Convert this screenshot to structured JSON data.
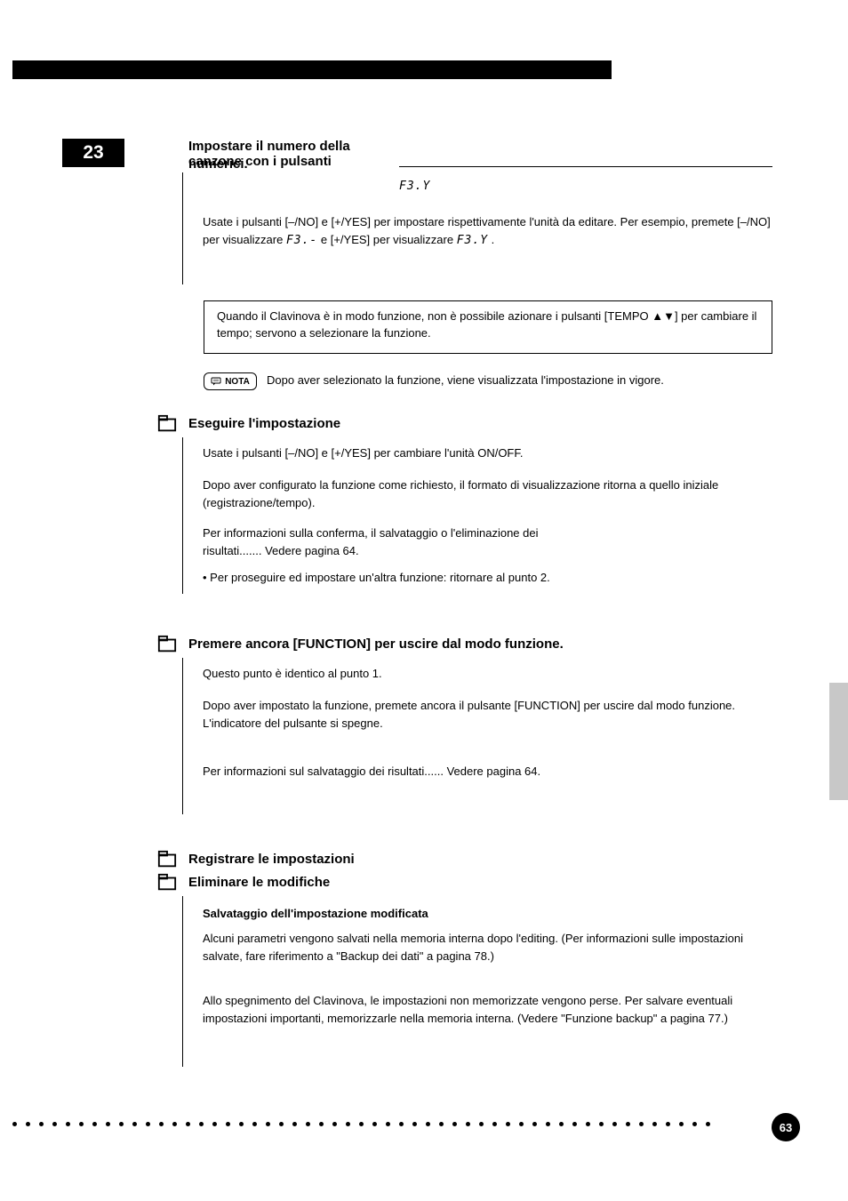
{
  "step_number": "23",
  "sec1": {
    "line1": "Impostare il numero della canzone con i pulsanti",
    "line2_a": "numerici.",
    "code_top": "F3.Y",
    "para2_a": "Usate i pulsanti [–/NO] e [+/YES] per impostare rispettivamente",
    "para2_b": "l'unità da editare. Per esempio, premete [–/NO] per visualizzare ",
    "code_a": "F3.-",
    "para2_mid": " e [+/YES] ",
    "code_b": "F3.Y",
    "para2_end": " per visualizzare ",
    "para2_tail": "."
  },
  "callout": "Quando il Clavinova è in modo funzione, non è possibile azionare i pulsanti [TEMPO ▲▼] per cambiare il tempo; servono a selezionare la funzione.",
  "nota_label": "NOTA",
  "nota_text": "Dopo aver selezionato la funzione, viene visualizzata l'impostazione in vigore.",
  "sec2": {
    "head": "Eseguire l'impostazione",
    "p1": "Usate i pulsanti [–/NO] e [+/YES] per cambiare l'unità ON/OFF.",
    "p2": "Dopo aver configurato la funzione come richiesto, il formato di visualizzazione ritorna a quello iniziale (registrazione/tempo).",
    "p3a": "Per informazioni sulla conferma, il salvataggio o l'eliminazione dei",
    "p3b": "risultati....... Vedere pagina 64.",
    "p4": "• Per proseguire ed impostare un'altra funzione: ritornare al punto 2."
  },
  "sec3": {
    "head": "Premere ancora [FUNCTION] per uscire dal modo funzione.",
    "p1": "Questo punto è identico al punto 1.",
    "p2": "Dopo aver impostato la funzione, premete ancora il pulsante [FUNCTION] per uscire dal modo funzione. L'indicatore del pulsante si spegne.",
    "p3": "Per informazioni sul salvataggio dei risultati...... Vedere pagina 64."
  },
  "sec4": {
    "head_a": "Registrare le impostazioni",
    "head_b": "Eliminare le modifiche",
    "p1": "Salvataggio dell'impostazione modificata",
    "p2": "Alcuni parametri vengono salvati nella memoria interna dopo l'editing. (Per informazioni sulle impostazioni salvate, fare riferimento a \"Backup dei dati\" a pagina 78.)",
    "p3": "Allo spegnimento del Clavinova, le impostazioni non memorizzate vengono perse. Per salvare eventuali impostazioni importanti, memorizzarle nella memoria interna. (Vedere \"Funzione backup\" a pagina 77.)"
  },
  "page_number": "63"
}
